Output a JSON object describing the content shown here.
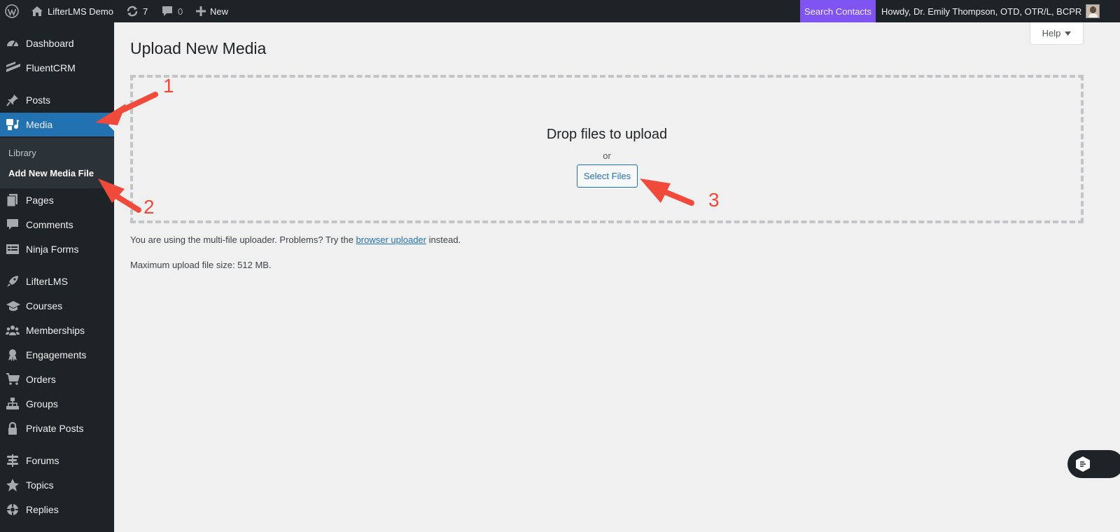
{
  "admin_bar": {
    "site_name": "LifterLMS Demo",
    "updates_count": "7",
    "comments_count": "0",
    "new_label": "New",
    "search_contacts": "Search Contacts",
    "howdy": "Howdy, Dr. Emily Thompson, OTD, OTR/L, BCPR"
  },
  "sidebar": {
    "items": [
      {
        "label": "Dashboard",
        "icon": "dashboard-icon"
      },
      {
        "label": "FluentCRM",
        "icon": "fluentcrm-icon"
      },
      {
        "label": "Posts",
        "icon": "pin-icon"
      },
      {
        "label": "Media",
        "icon": "media-icon"
      },
      {
        "label": "Pages",
        "icon": "pages-icon"
      },
      {
        "label": "Comments",
        "icon": "comment-icon"
      },
      {
        "label": "Ninja Forms",
        "icon": "forms-icon"
      },
      {
        "label": "LifterLMS",
        "icon": "rocket-icon"
      },
      {
        "label": "Courses",
        "icon": "graduation-cap-icon"
      },
      {
        "label": "Memberships",
        "icon": "groups-icon"
      },
      {
        "label": "Engagements",
        "icon": "award-icon"
      },
      {
        "label": "Orders",
        "icon": "cart-icon"
      },
      {
        "label": "Groups",
        "icon": "networking-icon"
      },
      {
        "label": "Private Posts",
        "icon": "lock-icon"
      },
      {
        "label": "Forums",
        "icon": "forums-icon"
      },
      {
        "label": "Topics",
        "icon": "topics-icon"
      },
      {
        "label": "Replies",
        "icon": "replies-icon"
      }
    ],
    "submenu": [
      {
        "label": "Library"
      },
      {
        "label": "Add New Media File"
      }
    ]
  },
  "main": {
    "help_label": "Help",
    "page_title": "Upload New Media",
    "drop_title": "Drop files to upload",
    "drop_or": "or",
    "select_files": "Select Files",
    "uploader_note_before": "You are using the multi-file uploader. Problems? Try the",
    "uploader_link": "browser uploader",
    "uploader_note_after": "instead.",
    "max_size": "Maximum upload file size: 512 MB."
  },
  "annotations": {
    "labels": [
      "1",
      "2",
      "3"
    ],
    "color": "#f04a3a"
  },
  "colors": {
    "admin_bar_bg": "#1d2327",
    "accent": "#2271b1",
    "search_contacts_bg": "#7f54f3",
    "page_bg": "#f0f0f1"
  }
}
